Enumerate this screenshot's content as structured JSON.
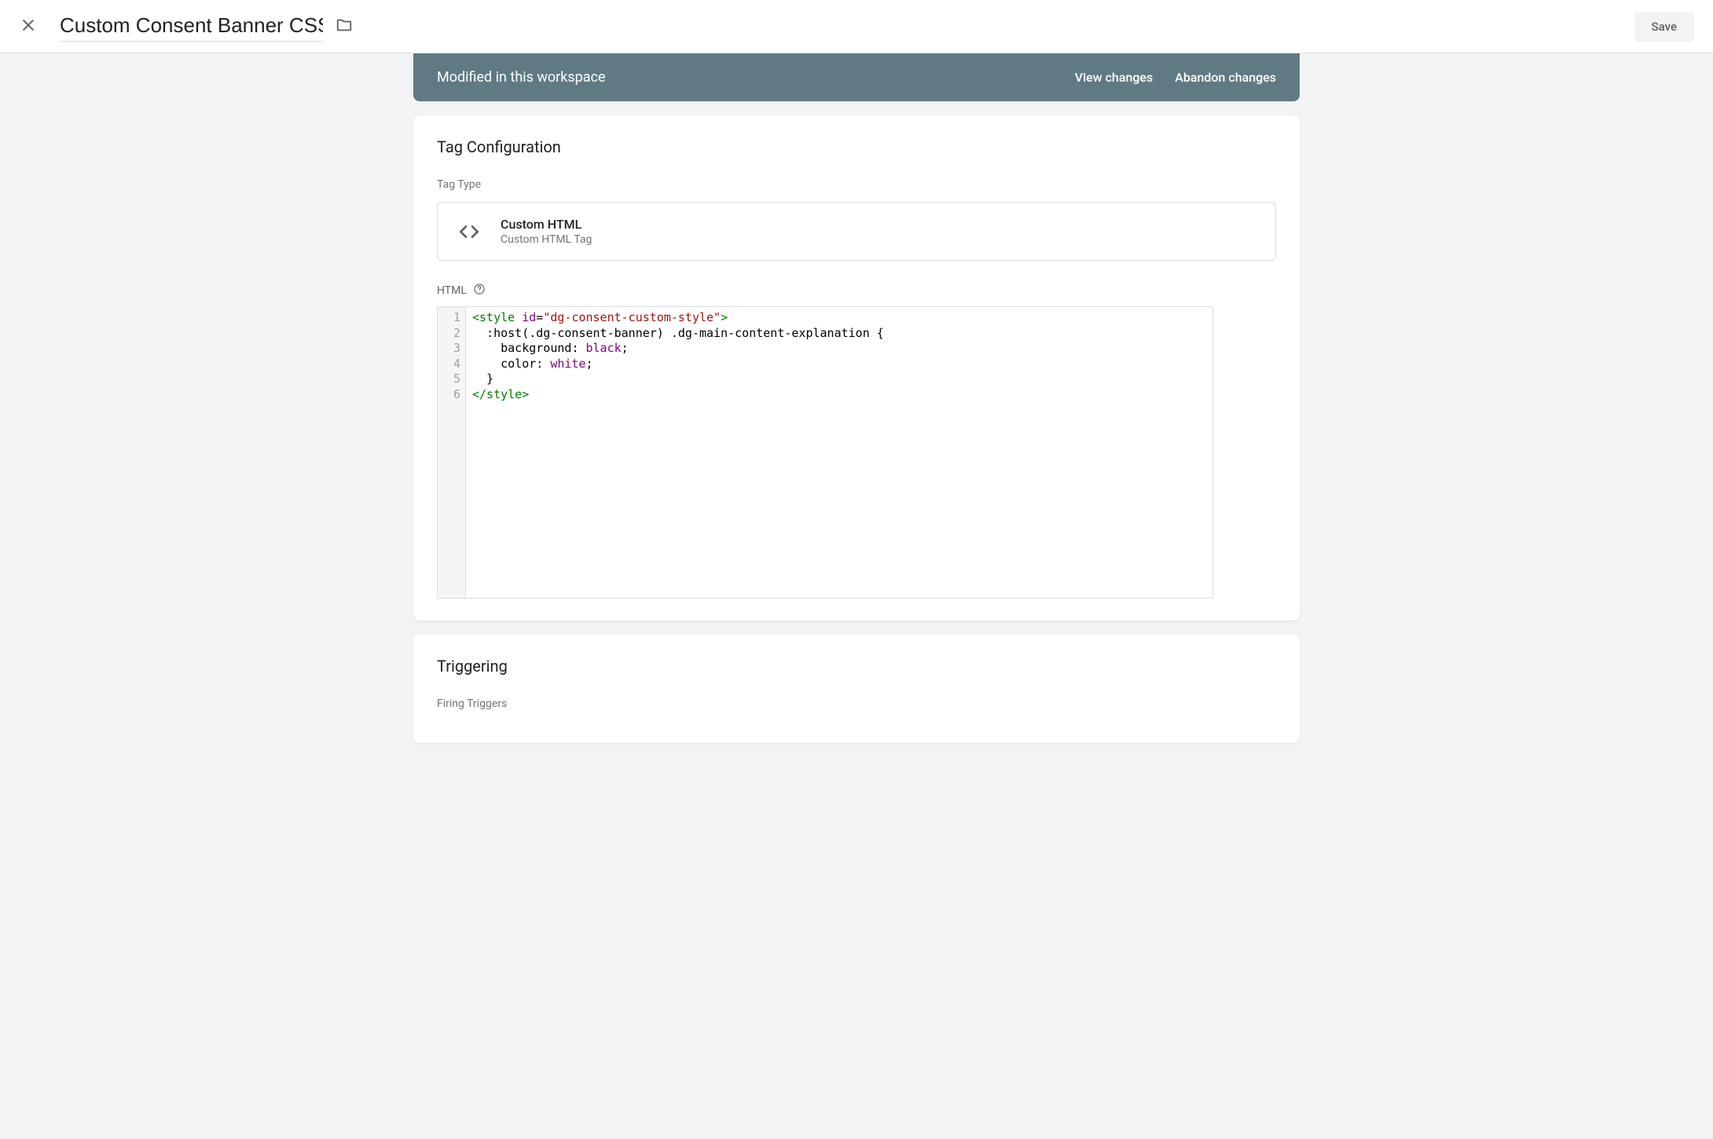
{
  "header": {
    "title": "Custom Consent Banner CSS",
    "save_label": "Save"
  },
  "workspace_banner": {
    "label": "Modified in this workspace",
    "view_changes": "View changes",
    "abandon_changes": "Abandon changes"
  },
  "tag_config": {
    "title": "Tag Configuration",
    "tag_type_label": "Tag Type",
    "tag_type_name": "Custom HTML",
    "tag_type_desc": "Custom HTML Tag",
    "html_label": "HTML",
    "code_lines": [
      [
        {
          "t": "<style",
          "c": "tok-tag"
        },
        {
          "t": " ",
          "c": ""
        },
        {
          "t": "id",
          "c": "tok-attr"
        },
        {
          "t": "=",
          "c": "tok-punc"
        },
        {
          "t": "\"dg-consent-custom-style\"",
          "c": "tok-str"
        },
        {
          "t": ">",
          "c": "tok-tag"
        }
      ],
      [
        {
          "t": "  :host(.dg-consent-banner) .dg-main-content-explanation {",
          "c": "tok-sel"
        }
      ],
      [
        {
          "t": "    background",
          "c": "tok-prop"
        },
        {
          "t": ": ",
          "c": "tok-punc"
        },
        {
          "t": "black",
          "c": "tok-val"
        },
        {
          "t": ";",
          "c": "tok-punc"
        }
      ],
      [
        {
          "t": "    color",
          "c": "tok-prop"
        },
        {
          "t": ": ",
          "c": "tok-punc"
        },
        {
          "t": "white",
          "c": "tok-val"
        },
        {
          "t": ";",
          "c": "tok-punc"
        }
      ],
      [
        {
          "t": "  }",
          "c": "tok-sel"
        }
      ],
      [
        {
          "t": "</style>",
          "c": "tok-tag"
        }
      ]
    ],
    "line_count": 6
  },
  "triggering": {
    "title": "Triggering",
    "firing_label": "Firing Triggers"
  }
}
